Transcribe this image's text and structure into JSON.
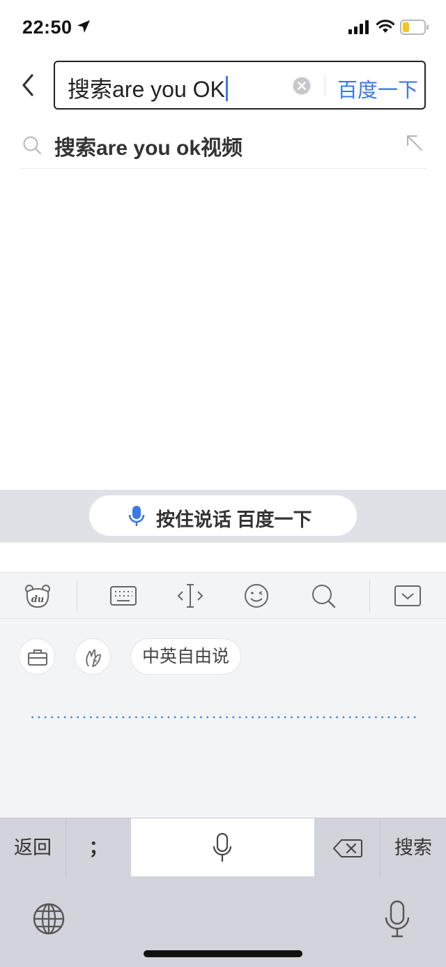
{
  "status_bar": {
    "time": "22:50",
    "icons": [
      "location-arrow-icon",
      "signal-icon",
      "wifi-icon",
      "battery-icon"
    ]
  },
  "header": {
    "back_icon": "chevron-left-icon",
    "search_value": "搜索are you OK",
    "clear_icon": "clear-circle-icon",
    "search_button": "百度一下"
  },
  "suggestions": [
    {
      "text": "搜索are you ok视频",
      "icon": "search-icon",
      "fill_icon": "arrow-up-left-icon"
    }
  ],
  "keyboard": {
    "voice_button": "按住说话 百度一下",
    "toolbar_icons": [
      "du-logo-icon",
      "keyboard-icon",
      "cursor-move-icon",
      "emoji-icon",
      "search-icon",
      "hide-keyboard-icon"
    ],
    "panel": {
      "icons": [
        "briefcase-icon",
        "gesture-icon"
      ],
      "mode_chip": "中英自由说"
    },
    "keys": {
      "back": "返回",
      "semicolon": "；",
      "search": "搜索"
    },
    "bottom_icons": [
      "globe-icon",
      "dictation-mic-icon"
    ]
  },
  "colors": {
    "accent": "#3b78e7",
    "keyboard_bg": "#d1d4da",
    "panel_bg": "#f3f4f6",
    "battery_fill": "#f5c518"
  }
}
